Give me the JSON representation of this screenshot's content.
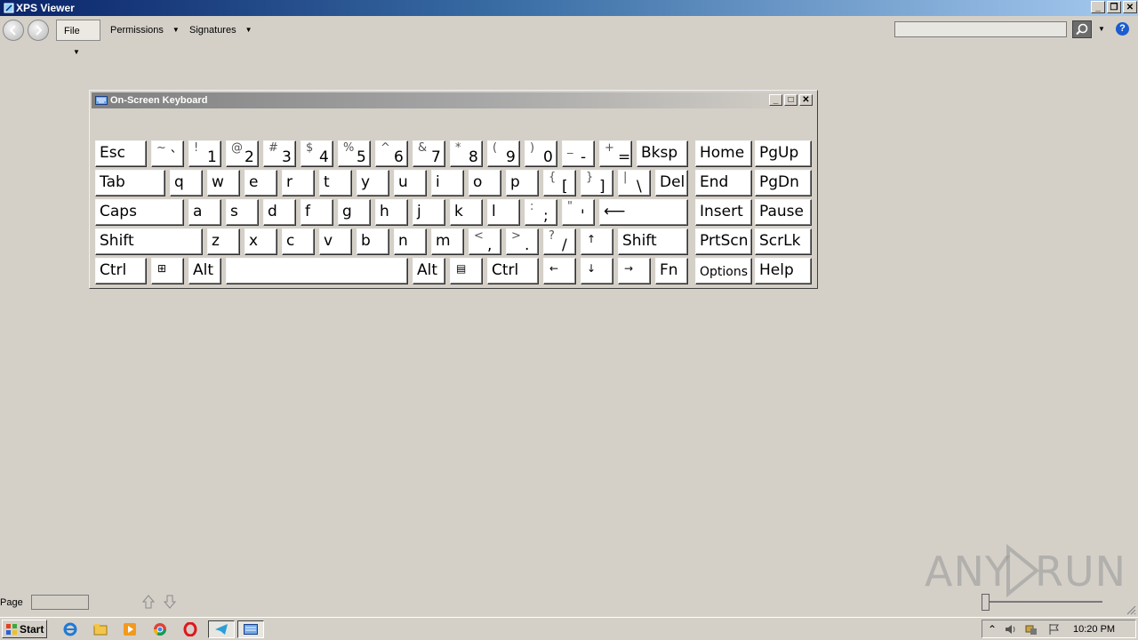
{
  "window": {
    "title": "XPS Viewer"
  },
  "toolbar": {
    "file_label": "File",
    "permissions_label": "Permissions",
    "signatures_label": "Signatures",
    "search_value": ""
  },
  "osk": {
    "title": "On-Screen Keyboard",
    "rows": [
      [
        {
          "n": "esc",
          "t": "Esc"
        },
        {
          "n": "tilde",
          "s": "~",
          "m": "`"
        },
        {
          "n": "1",
          "s": "!",
          "m": "1"
        },
        {
          "n": "2",
          "s": "@",
          "m": "2"
        },
        {
          "n": "3",
          "s": "#",
          "m": "3"
        },
        {
          "n": "4",
          "s": "$",
          "m": "4"
        },
        {
          "n": "5",
          "s": "%",
          "m": "5"
        },
        {
          "n": "6",
          "s": "^",
          "m": "6"
        },
        {
          "n": "7",
          "s": "&",
          "m": "7"
        },
        {
          "n": "8",
          "s": "*",
          "m": "8"
        },
        {
          "n": "9",
          "s": "(",
          "m": "9"
        },
        {
          "n": "0",
          "s": ")",
          "m": "0"
        },
        {
          "n": "minus",
          "s": "_",
          "m": "-"
        },
        {
          "n": "equals",
          "s": "+",
          "m": "="
        },
        {
          "n": "bksp",
          "t": "Bksp"
        },
        {
          "n": "home",
          "t": "Home"
        },
        {
          "n": "pgup",
          "t": "PgUp"
        }
      ],
      [
        {
          "n": "tab",
          "t": "Tab"
        },
        {
          "n": "q",
          "t": "q"
        },
        {
          "n": "w",
          "t": "w"
        },
        {
          "n": "e",
          "t": "e"
        },
        {
          "n": "r",
          "t": "r"
        },
        {
          "n": "t",
          "t": "t"
        },
        {
          "n": "y",
          "t": "y"
        },
        {
          "n": "u",
          "t": "u"
        },
        {
          "n": "i",
          "t": "i"
        },
        {
          "n": "o",
          "t": "o"
        },
        {
          "n": "p",
          "t": "p"
        },
        {
          "n": "lbracket",
          "s": "{",
          "m": "["
        },
        {
          "n": "rbracket",
          "s": "}",
          "m": "]"
        },
        {
          "n": "backslash",
          "s": "|",
          "m": "\\"
        },
        {
          "n": "del",
          "t": "Del"
        },
        {
          "n": "end",
          "t": "End"
        },
        {
          "n": "pgdn",
          "t": "PgDn"
        }
      ],
      [
        {
          "n": "caps",
          "t": "Caps"
        },
        {
          "n": "a",
          "t": "a"
        },
        {
          "n": "s",
          "t": "s"
        },
        {
          "n": "d",
          "t": "d"
        },
        {
          "n": "f",
          "t": "f"
        },
        {
          "n": "g",
          "t": "g"
        },
        {
          "n": "h",
          "t": "h"
        },
        {
          "n": "j",
          "t": "j"
        },
        {
          "n": "k",
          "t": "k"
        },
        {
          "n": "l",
          "t": "l"
        },
        {
          "n": "semicolon",
          "s": ":",
          "m": ";"
        },
        {
          "n": "quote",
          "s": "\"",
          "m": "'"
        },
        {
          "n": "enter",
          "t": "⟵"
        },
        {
          "n": "insert",
          "t": "Insert"
        },
        {
          "n": "pause",
          "t": "Pause"
        }
      ],
      [
        {
          "n": "shift-left",
          "t": "Shift"
        },
        {
          "n": "z",
          "t": "z"
        },
        {
          "n": "x",
          "t": "x"
        },
        {
          "n": "c",
          "t": "c"
        },
        {
          "n": "v",
          "t": "v"
        },
        {
          "n": "b",
          "t": "b"
        },
        {
          "n": "n",
          "t": "n"
        },
        {
          "n": "m",
          "t": "m"
        },
        {
          "n": "comma",
          "s": "<",
          "m": ","
        },
        {
          "n": "period",
          "s": ">",
          "m": "."
        },
        {
          "n": "slash",
          "s": "?",
          "m": "/"
        },
        {
          "n": "arrow-up",
          "t": "↑"
        },
        {
          "n": "shift-right",
          "t": "Shift"
        },
        {
          "n": "prtscn",
          "t": "PrtScn"
        },
        {
          "n": "scrlk",
          "t": "ScrLk"
        }
      ],
      [
        {
          "n": "ctrl-left",
          "t": "Ctrl"
        },
        {
          "n": "win",
          "t": "⊞"
        },
        {
          "n": "alt-left",
          "t": "Alt"
        },
        {
          "n": "space",
          "t": ""
        },
        {
          "n": "alt-right",
          "t": "Alt"
        },
        {
          "n": "menu",
          "t": "▤"
        },
        {
          "n": "ctrl-right",
          "t": "Ctrl"
        },
        {
          "n": "arrow-left",
          "t": "←"
        },
        {
          "n": "arrow-down",
          "t": "↓"
        },
        {
          "n": "arrow-right",
          "t": "→"
        },
        {
          "n": "fn",
          "t": "Fn"
        },
        {
          "n": "options",
          "t": "Options"
        },
        {
          "n": "help",
          "t": "Help"
        }
      ]
    ]
  },
  "status": {
    "page_label": "Page",
    "page_value": ""
  },
  "watermark": {
    "left": "ANY",
    "right": "RUN"
  },
  "taskbar": {
    "start_label": "Start",
    "apps": [
      "ie-icon",
      "explorer-icon",
      "media-player-icon",
      "chrome-icon",
      "opera-icon",
      "telegram-icon",
      "osk-icon"
    ],
    "clock": "10:20 PM"
  }
}
